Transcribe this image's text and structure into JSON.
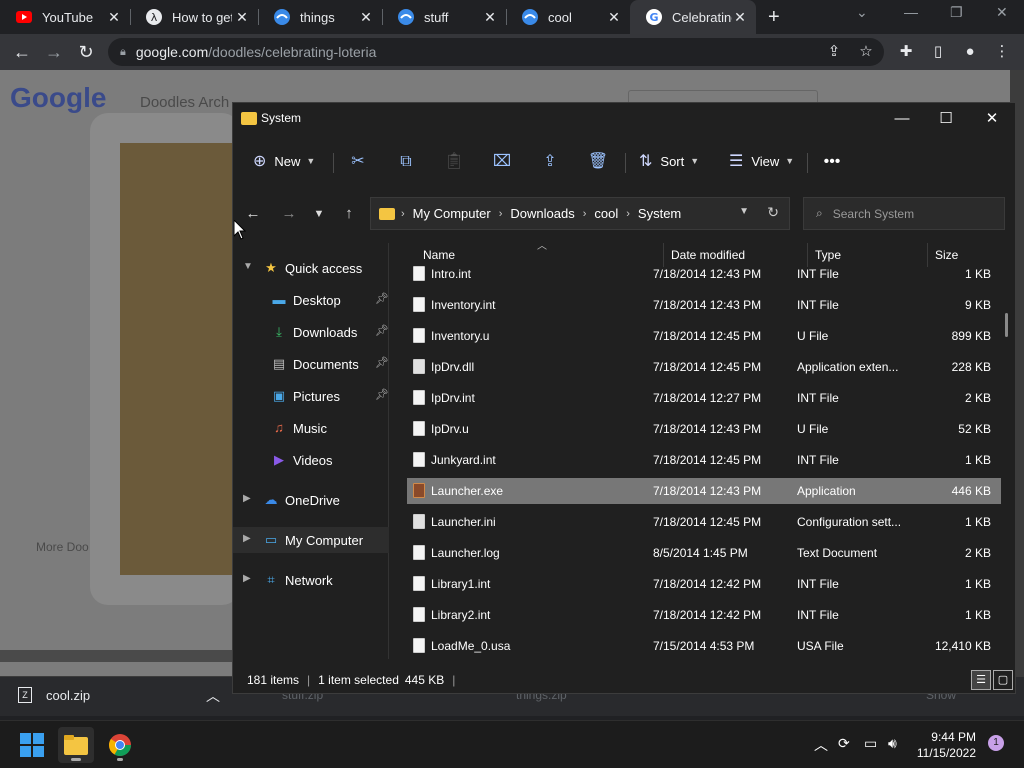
{
  "browser": {
    "tabs": [
      {
        "title": "YouTube",
        "icon": "youtube-icon"
      },
      {
        "title": "How to get",
        "icon": "lambda-icon"
      },
      {
        "title": "things",
        "icon": "edge-file-icon"
      },
      {
        "title": "stuff",
        "icon": "edge-file-icon"
      },
      {
        "title": "cool",
        "icon": "edge-file-icon"
      },
      {
        "title": "Celebrating",
        "icon": "google-icon"
      }
    ],
    "url_host": "google.com",
    "url_path": "/doodles/celebrating-loteria",
    "page": {
      "logo": "Google",
      "archive_text": "Doodles Arch",
      "more_text": "More Doo"
    },
    "downloads": [
      {
        "name": "cool.zip"
      },
      {
        "name": "stuff.zip"
      },
      {
        "name": "things.zip"
      }
    ],
    "show_all": "Show"
  },
  "explorer": {
    "title": "System",
    "commands": {
      "new": "New",
      "sort": "Sort",
      "view": "View"
    },
    "breadcrumb": [
      "My Computer",
      "Downloads",
      "cool",
      "System"
    ],
    "search_placeholder": "Search System",
    "nav": [
      {
        "label": "Quick access",
        "icon": "star-icon",
        "color": "#f4c542"
      },
      {
        "label": "Desktop",
        "icon": "desktop-icon",
        "color": "#4aa8e8"
      },
      {
        "label": "Downloads",
        "icon": "download-icon",
        "color": "#3ac06a"
      },
      {
        "label": "Documents",
        "icon": "documents-icon",
        "color": "#bbbbbb"
      },
      {
        "label": "Pictures",
        "icon": "pictures-icon",
        "color": "#4aa8e8"
      },
      {
        "label": "Music",
        "icon": "music-icon",
        "color": "#e86a4a"
      },
      {
        "label": "Videos",
        "icon": "videos-icon",
        "color": "#8a5ae8"
      },
      {
        "label": "OneDrive",
        "icon": "cloud-icon",
        "color": "#3a8ae8"
      },
      {
        "label": "My Computer",
        "icon": "computer-icon",
        "color": "#4aa8e8"
      },
      {
        "label": "Network",
        "icon": "network-icon",
        "color": "#4aa8e8"
      }
    ],
    "columns": {
      "name": "Name",
      "date": "Date modified",
      "type": "Type",
      "size": "Size"
    },
    "files": [
      {
        "name": "Intro.int",
        "date": "7/18/2014 12:43 PM",
        "type": "INT File",
        "size": "1 KB",
        "icon": "file"
      },
      {
        "name": "Inventory.int",
        "date": "7/18/2014 12:43 PM",
        "type": "INT File",
        "size": "9 KB",
        "icon": "file"
      },
      {
        "name": "Inventory.u",
        "date": "7/18/2014 12:45 PM",
        "type": "U File",
        "size": "899 KB",
        "icon": "file"
      },
      {
        "name": "IpDrv.dll",
        "date": "7/18/2014 12:45 PM",
        "type": "Application exten...",
        "size": "228 KB",
        "icon": "dll"
      },
      {
        "name": "IpDrv.int",
        "date": "7/18/2014 12:27 PM",
        "type": "INT File",
        "size": "2 KB",
        "icon": "file"
      },
      {
        "name": "IpDrv.u",
        "date": "7/18/2014 12:43 PM",
        "type": "U File",
        "size": "52 KB",
        "icon": "file"
      },
      {
        "name": "Junkyard.int",
        "date": "7/18/2014 12:45 PM",
        "type": "INT File",
        "size": "1 KB",
        "icon": "file"
      },
      {
        "name": "Launcher.exe",
        "date": "7/18/2014 12:43 PM",
        "type": "Application",
        "size": "446 KB",
        "icon": "exe",
        "selected": true
      },
      {
        "name": "Launcher.ini",
        "date": "7/18/2014 12:45 PM",
        "type": "Configuration sett...",
        "size": "1 KB",
        "icon": "dll"
      },
      {
        "name": "Launcher.log",
        "date": "8/5/2014 1:45 PM",
        "type": "Text Document",
        "size": "2 KB",
        "icon": "file"
      },
      {
        "name": "Library1.int",
        "date": "7/18/2014 12:42 PM",
        "type": "INT File",
        "size": "1 KB",
        "icon": "file"
      },
      {
        "name": "Library2.int",
        "date": "7/18/2014 12:42 PM",
        "type": "INT File",
        "size": "1 KB",
        "icon": "file"
      },
      {
        "name": "LoadMe_0.usa",
        "date": "7/15/2014 4:53 PM",
        "type": "USA File",
        "size": "12,410 KB",
        "icon": "file"
      }
    ],
    "status": {
      "items": "181 items",
      "selected": "1 item selected",
      "size": "445 KB"
    }
  },
  "taskbar": {
    "time": "9:44 PM",
    "date": "11/15/2022",
    "notifications": "1"
  }
}
